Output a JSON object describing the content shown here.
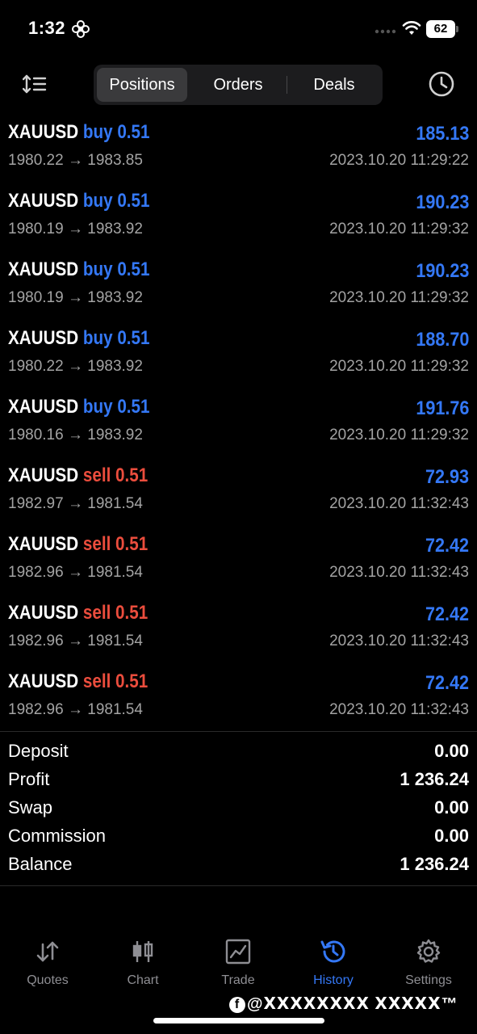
{
  "status_bar": {
    "time": "1:32",
    "battery": "62"
  },
  "toolbar": {
    "tabs": [
      {
        "label": "Positions",
        "active": true
      },
      {
        "label": "Orders",
        "active": false
      },
      {
        "label": "Deals",
        "active": false
      }
    ]
  },
  "deals": [
    {
      "symbol": "XAUUSD",
      "side": "buy",
      "volume": "0.51",
      "profit": "185.13",
      "open": "1980.22",
      "close": "1983.85",
      "time": "2023.10.20 11:29:22"
    },
    {
      "symbol": "XAUUSD",
      "side": "buy",
      "volume": "0.51",
      "profit": "190.23",
      "open": "1980.19",
      "close": "1983.92",
      "time": "2023.10.20 11:29:32"
    },
    {
      "symbol": "XAUUSD",
      "side": "buy",
      "volume": "0.51",
      "profit": "190.23",
      "open": "1980.19",
      "close": "1983.92",
      "time": "2023.10.20 11:29:32"
    },
    {
      "symbol": "XAUUSD",
      "side": "buy",
      "volume": "0.51",
      "profit": "188.70",
      "open": "1980.22",
      "close": "1983.92",
      "time": "2023.10.20 11:29:32"
    },
    {
      "symbol": "XAUUSD",
      "side": "buy",
      "volume": "0.51",
      "profit": "191.76",
      "open": "1980.16",
      "close": "1983.92",
      "time": "2023.10.20 11:29:32"
    },
    {
      "symbol": "XAUUSD",
      "side": "sell",
      "volume": "0.51",
      "profit": "72.93",
      "open": "1982.97",
      "close": "1981.54",
      "time": "2023.10.20 11:32:43"
    },
    {
      "symbol": "XAUUSD",
      "side": "sell",
      "volume": "0.51",
      "profit": "72.42",
      "open": "1982.96",
      "close": "1981.54",
      "time": "2023.10.20 11:32:43"
    },
    {
      "symbol": "XAUUSD",
      "side": "sell",
      "volume": "0.51",
      "profit": "72.42",
      "open": "1982.96",
      "close": "1981.54",
      "time": "2023.10.20 11:32:43"
    },
    {
      "symbol": "XAUUSD",
      "side": "sell",
      "volume": "0.51",
      "profit": "72.42",
      "open": "1982.96",
      "close": "1981.54",
      "time": "2023.10.20 11:32:43"
    }
  ],
  "summary": [
    {
      "label": "Deposit",
      "value": "0.00"
    },
    {
      "label": "Profit",
      "value": "1 236.24"
    },
    {
      "label": "Swap",
      "value": "0.00"
    },
    {
      "label": "Commission",
      "value": "0.00"
    },
    {
      "label": "Balance",
      "value": "1 236.24"
    }
  ],
  "tabbar": {
    "items": [
      {
        "label": "Quotes",
        "icon": "quotes-icon",
        "active": false
      },
      {
        "label": "Chart",
        "icon": "chart-icon",
        "active": false
      },
      {
        "label": "Trade",
        "icon": "trade-icon",
        "active": false
      },
      {
        "label": "History",
        "icon": "history-icon",
        "active": true
      },
      {
        "label": "Settings",
        "icon": "settings-icon",
        "active": false
      }
    ]
  },
  "watermark": "@ⅩⅩⅩⅩⅩⅩⅩⅩ ⅩⅩⅩⅩⅩ™",
  "colors": {
    "accent": "#3478f6",
    "sell": "#eb4d3d",
    "muted": "#a3a3a3"
  }
}
